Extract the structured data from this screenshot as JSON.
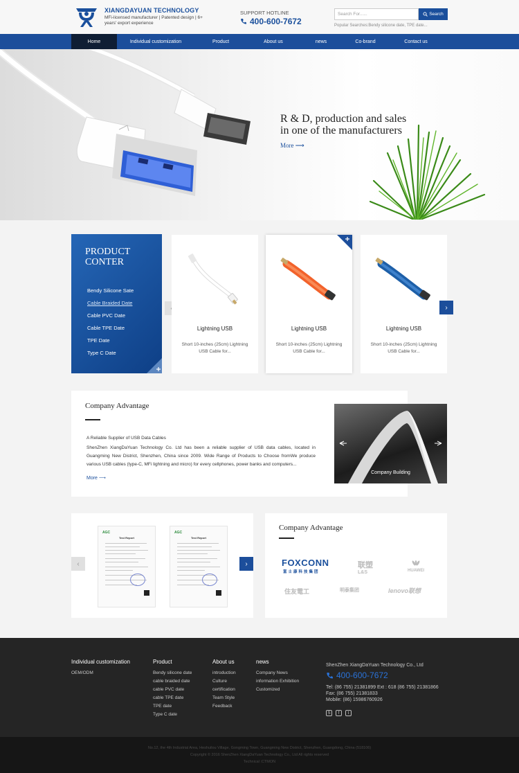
{
  "header": {
    "logo_title": "XIANGDAYUAN TECHNOLOGY",
    "logo_tagline": "MFi-licensed manufacturer | Patented design | 6+ years' export experience",
    "hotline_label": "SUPPORT HOTLINE",
    "hotline_number": "400-600-7672",
    "search_placeholder": "Search For......",
    "search_button": "Search",
    "popular": "Popular Searches:Bendy silicone date,  TPE date..."
  },
  "nav": [
    "Home",
    "Individual customization",
    "Product",
    "About  us",
    "news",
    "Co-brand",
    "Contact us"
  ],
  "banner": {
    "title_line1": "R & D, production and sales",
    "title_line2": "in one of the manufacturers",
    "more": "More ⟶"
  },
  "products": {
    "side_title_line1": "PRODUCT",
    "side_title_line2": "CONTER",
    "categories": [
      "Bendy Silicone Sate",
      "Cable Braided Date",
      "Cable PVC Date",
      "Cable TPE Date",
      "TPE Date",
      "Type C Date"
    ],
    "items": [
      {
        "name": "Lightning USB",
        "desc": "Short 10-inches (25cm) Lightning USB Cable for...",
        "color": "#ffffff"
      },
      {
        "name": "Lightning USB",
        "desc": "Short 10-inches (25cm) Lightning USB Cable for...",
        "color": "#f2622b"
      },
      {
        "name": "Lightning USB",
        "desc": "Short 10-inches (25cm) Lightning USB Cable for...",
        "color": "#1d5fa8"
      }
    ]
  },
  "company": {
    "title": "Company Advantage",
    "subtitle": "A Reliable Supplier of USB Data Cables",
    "text": "ShenZhen XiangDaYuan Technology Co. Ltd has been a reliable supplier of USB data cables, located in Guangming New District, Shenzhen, China since 2009. Wide Range of Products to Choose fromWe produce various USB cables (type-C, MFi lightning and micro) for every cellphones, power banks and computers...",
    "more": "More ⟶",
    "image_caption": "Company Building"
  },
  "advantage": {
    "title": "Company Advantage",
    "brands": [
      "FOXCONN",
      "富士康科技集团",
      "联塑",
      "L&S",
      "HUAWEI",
      "住友電工",
      "明泰集团",
      "lenovo联想"
    ]
  },
  "certs": {
    "logo": "AGC",
    "title": "Test Report"
  },
  "footer": {
    "columns": [
      {
        "title": "Individual customization",
        "items": [
          "OEM/ODM"
        ]
      },
      {
        "title": "Product",
        "items": [
          "Bendy silicone date",
          "cable   braided date",
          "cable  PVC date",
          "cable  TPE date",
          "TPE date",
          "Type C date"
        ]
      },
      {
        "title": "About  us",
        "items": [
          "introduction",
          "Culture",
          "certification",
          "Team Style",
          "Feedback"
        ]
      },
      {
        "title": "news",
        "items": [
          "Company News",
          "information  Exhibition",
          "Customized"
        ]
      }
    ],
    "company_name": "ShenZhen XiangDaYuan Technology Co., Ltd",
    "phone": "400-600-7672",
    "tel": "Tel:  (86 755) 21381899  Ext : 618  (86 755) 21381866",
    "fax": "Fax:  (86 755) 21381833",
    "mobile": "Mobile:  (86) 15986760926",
    "bottom_address": "No.12, the 4th Industrial Area, Heshuilou Village, Gongming Town, Guangming New District, Shenzhen, Guangdong, China (518106)",
    "bottom_copyright": "Copyright © 2016 ShenZhen XiangDaYuan Technology Co., Ltd  All rights reserved",
    "bottom_tech": "Technical :CTMON"
  },
  "colors": {
    "brand_blue": "#1c4e9b",
    "nav_active": "#0f1e34",
    "footer_bg": "#252525"
  }
}
